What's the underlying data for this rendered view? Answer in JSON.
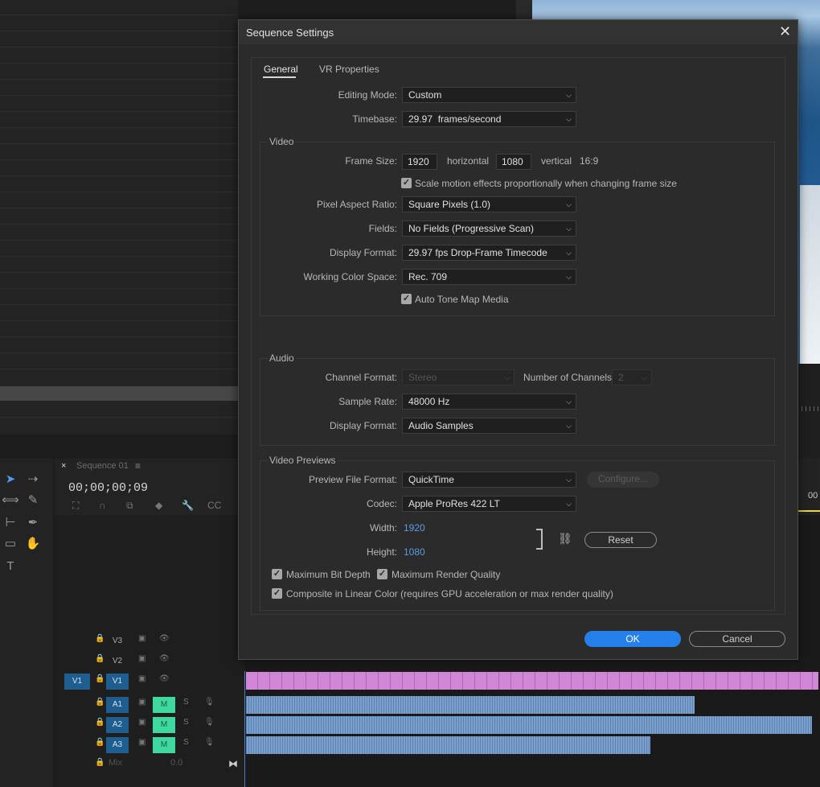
{
  "dialog": {
    "title": "Sequence Settings",
    "close_glyph": "✕",
    "tabs": [
      {
        "label": "General",
        "active": true
      },
      {
        "label": "VR Properties",
        "active": false
      }
    ],
    "editing_mode": {
      "label": "Editing Mode:",
      "value": "Custom"
    },
    "timebase": {
      "label": "Timebase:",
      "value": "29.97  frames/second"
    },
    "video": {
      "title": "Video",
      "frame_size_label": "Frame Size:",
      "frame_width": "1920",
      "horizontal_label": "horizontal",
      "frame_height": "1080",
      "vertical_label": "vertical",
      "aspect": "16:9",
      "scale_motion": {
        "label": "Scale motion effects proportionally when changing frame size",
        "checked": true
      },
      "pixel_aspect": {
        "label": "Pixel Aspect Ratio:",
        "value": "Square Pixels (1.0)"
      },
      "fields": {
        "label": "Fields:",
        "value": "No Fields (Progressive Scan)"
      },
      "display_format": {
        "label": "Display Format:",
        "value": "29.97 fps Drop-Frame Timecode"
      },
      "color_space": {
        "label": "Working Color Space:",
        "value": "Rec. 709"
      },
      "auto_tone_map": {
        "label": "Auto Tone Map Media",
        "checked": true
      }
    },
    "audio": {
      "title": "Audio",
      "channel_format": {
        "label": "Channel Format:",
        "value": "Stereo",
        "disabled": true
      },
      "num_channels": {
        "label": "Number of Channels:",
        "value": "2",
        "disabled": true
      },
      "sample_rate": {
        "label": "Sample Rate:",
        "value": "48000 Hz"
      },
      "display_format": {
        "label": "Display Format:",
        "value": "Audio Samples"
      }
    },
    "video_previews": {
      "title": "Video Previews",
      "file_format": {
        "label": "Preview File Format:",
        "value": "QuickTime"
      },
      "configure_label": "Configure...",
      "codec": {
        "label": "Codec:",
        "value": "Apple ProRes 422 LT"
      },
      "width": {
        "label": "Width:",
        "value": "1920"
      },
      "height": {
        "label": "Height:",
        "value": "1080"
      },
      "reset_label": "Reset",
      "max_bit_depth": {
        "label": "Maximum Bit Depth",
        "checked": true
      },
      "max_render_quality": {
        "label": "Maximum Render Quality",
        "checked": true
      },
      "linear_color": {
        "label": "Composite in Linear Color (requires GPU acceleration or max render quality)",
        "checked": true
      }
    },
    "ok_label": "OK",
    "cancel_label": "Cancel"
  },
  "timeline": {
    "tab_close": "×",
    "tab_label": "Sequence 01",
    "tab_menu": "≡",
    "timecode": "00;00;00;09",
    "ruler_time": "00",
    "tracks": {
      "v3": "V3",
      "v2": "V2",
      "v1_source": "V1",
      "v1": "V1",
      "a1": "A1",
      "a2": "A2",
      "a3": "A3",
      "mute": "M",
      "solo": "S",
      "mix_label": "Mix",
      "mix_value": "0.0"
    }
  },
  "colors": {
    "accent_blue": "#2680eb",
    "track_green": "#3fd9a0",
    "video_clip": "#d286d8",
    "audio_clip": "#7aa0cf"
  }
}
